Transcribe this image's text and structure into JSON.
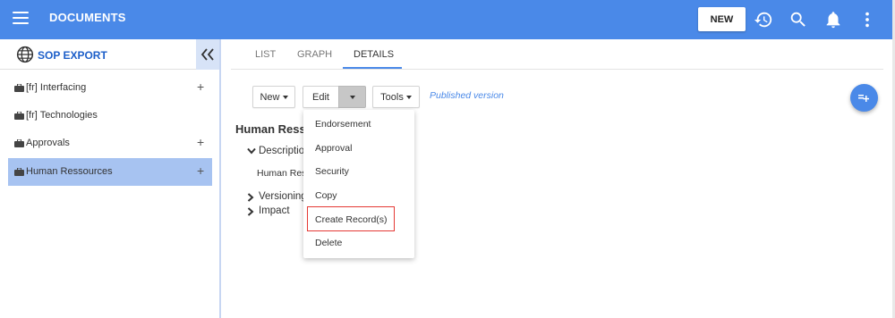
{
  "app": {
    "title": "DOCUMENTS",
    "new_label": "NEW"
  },
  "icons": {
    "menu": "hamburger-icon",
    "history": "history-icon",
    "search": "search-icon",
    "notifications": "bell-icon",
    "more": "more-vert-icon",
    "collapse": "double-chevron-left-icon",
    "globe": "globe-icon",
    "fab": "add-list-icon"
  },
  "colors": {
    "primary": "#4a89e8",
    "sidebar_active": "#a7c3f1",
    "sidebar_title": "#1d5fc9",
    "highlight": "#e53935"
  },
  "sidebar": {
    "title": "SOP EXPORT",
    "items": [
      {
        "label": "[fr] Interfacing",
        "has_add": true,
        "add": "+"
      },
      {
        "label": "[fr] Technologies",
        "has_add": false
      },
      {
        "label": "Approvals",
        "has_add": true,
        "add": "+"
      },
      {
        "label": "Human Ressources",
        "has_add": true,
        "add": "+",
        "active": true
      }
    ]
  },
  "tabs": [
    {
      "label": "LIST"
    },
    {
      "label": "GRAPH"
    },
    {
      "label": "DETAILS",
      "active": true
    }
  ],
  "toolbar": {
    "new_label": "New",
    "edit_label": "Edit",
    "tools_label": "Tools",
    "status": "Published version"
  },
  "detail": {
    "title": "Human Ress",
    "sections": [
      {
        "label": "Descriptio",
        "expanded": true,
        "content": "Human Res"
      },
      {
        "label": "Versioning",
        "expanded": false
      },
      {
        "label": "Impact",
        "expanded": false
      }
    ]
  },
  "edit_menu": {
    "items": [
      "Endorsement",
      "Approval",
      "Security",
      "Copy",
      "Create Record(s)",
      "Delete"
    ],
    "highlighted": "Create Record(s)"
  }
}
